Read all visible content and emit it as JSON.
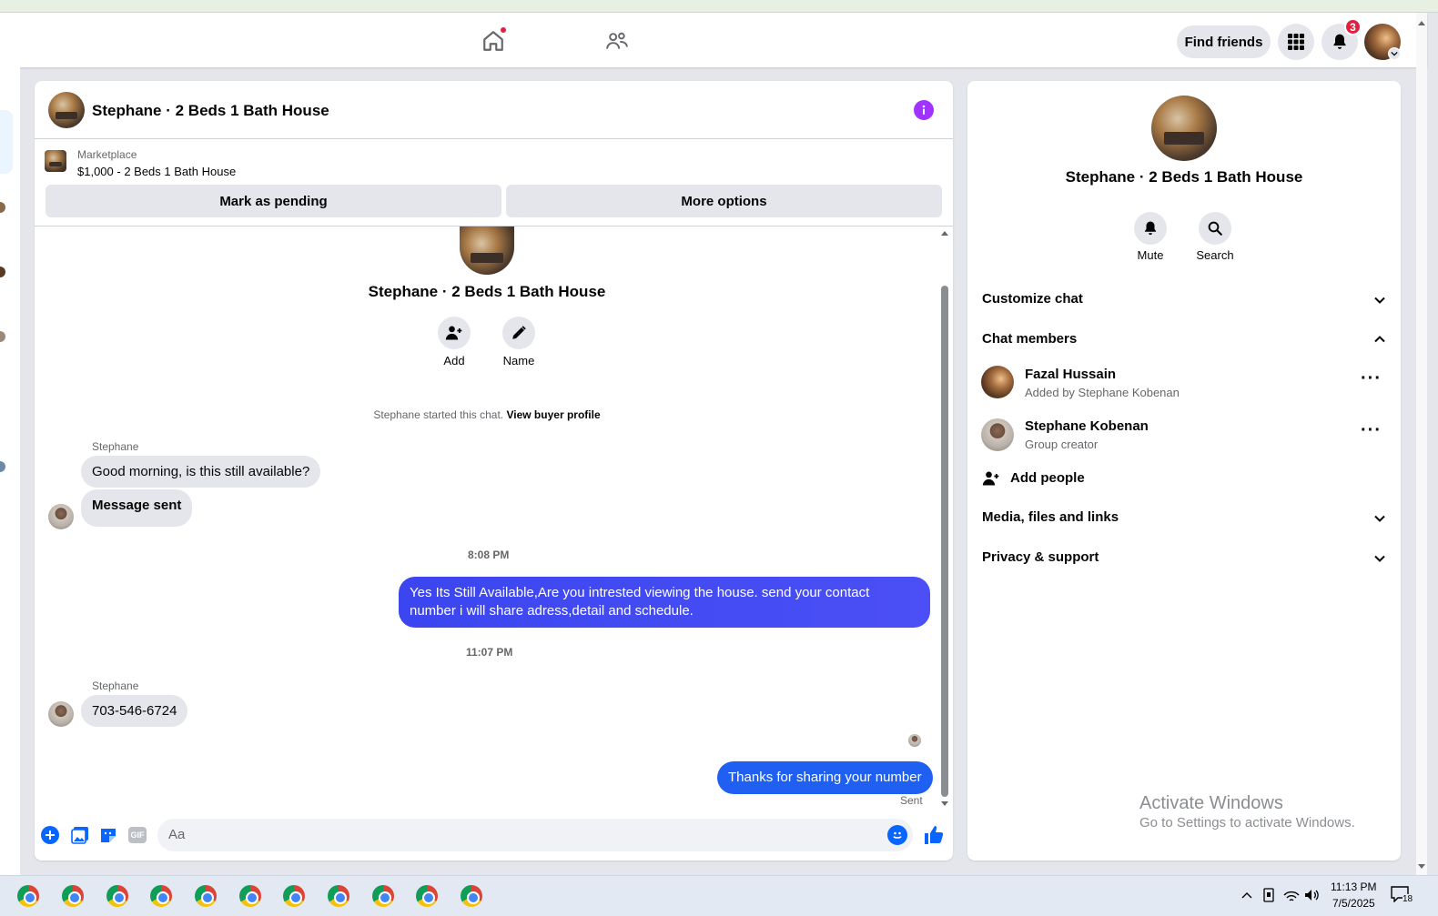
{
  "top_nav": {
    "find_friends_label": "Find friends",
    "notification_count": "3"
  },
  "chat": {
    "title": "Stephane · 2 Beds 1 Bath House",
    "marketplace": {
      "label": "Marketplace",
      "listing": "$1,000 - 2 Beds 1 Bath House"
    },
    "actions": {
      "mark_pending": "Mark as pending",
      "more_options": "More options"
    },
    "intro": {
      "name": "Stephane · 2 Beds 1 Bath House",
      "add_label": "Add",
      "name_label": "Name",
      "started_text": "Stephane started this chat.",
      "view_buyer_profile": "View buyer profile"
    },
    "messages": [
      {
        "sender": "Stephane",
        "text": "Good morning, is this still available?"
      },
      {
        "text": "Message sent"
      },
      {
        "timestamp": "8:08 PM"
      },
      {
        "text": "Yes Its Still Available,Are you intrested viewing the house. send your contact number i will share adress,detail and schedule."
      },
      {
        "timestamp": "11:07 PM"
      },
      {
        "sender": "Stephane",
        "text": "703-546-6724"
      },
      {
        "text": "Thanks for sharing your number",
        "status": "Sent"
      }
    ],
    "composer": {
      "placeholder": "Aa"
    }
  },
  "side_panel": {
    "title": "Stephane · 2 Beds 1 Bath House",
    "mute_label": "Mute",
    "search_label": "Search",
    "sections": {
      "customize": "Customize chat",
      "members": "Chat members",
      "media": "Media, files and links",
      "privacy": "Privacy & support"
    },
    "members": [
      {
        "name": "Fazal Hussain",
        "sub": "Added by Stephane Kobenan"
      },
      {
        "name": "Stephane Kobenan",
        "sub": "Group creator"
      }
    ],
    "add_people": "Add people"
  },
  "watermark": {
    "line1": "Activate Windows",
    "line2": "Go to Settings to activate Windows."
  },
  "taskbar": {
    "time": "11:13 PM",
    "date": "7/5/2025",
    "notification_count": "18"
  },
  "colors": {
    "accent": "#0866ff",
    "gradient_blue": "#3a4cf5",
    "info_purple": "#a033ff"
  }
}
